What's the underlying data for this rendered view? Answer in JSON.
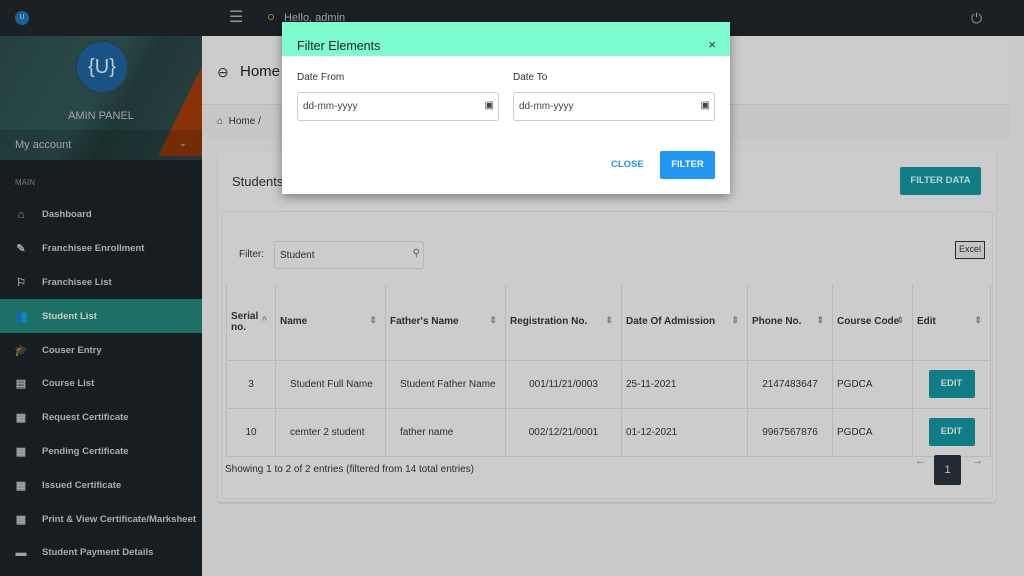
{
  "topbar": {
    "greeting": "Hello, admin",
    "logo": "U"
  },
  "sidebar": {
    "avatar": "{U}",
    "panel_name": "AMIN PANEL",
    "account": "My account",
    "section": "MAIN",
    "items": [
      {
        "label": "Dashboard",
        "icon": "⌂"
      },
      {
        "label": "Franchisee Enrollment",
        "icon": "✎"
      },
      {
        "label": "Franchisee List",
        "icon": "⚐"
      },
      {
        "label": "Student List",
        "icon": "👥"
      },
      {
        "label": "Couser Entry",
        "icon": "🎓"
      },
      {
        "label": "Course List",
        "icon": "▤"
      },
      {
        "label": "Request Certificate",
        "icon": "▦"
      },
      {
        "label": "Pending Certificate",
        "icon": "▦"
      },
      {
        "label": "Issued Certificate",
        "icon": "▦"
      },
      {
        "label": "Print & View Certificate/Marksheet",
        "icon": "▦"
      },
      {
        "label": "Student Payment Details",
        "icon": "▬"
      }
    ]
  },
  "header": {
    "title": "Home",
    "breadcrumb": "Home"
  },
  "card": {
    "title": "Students",
    "filter_data": "FILTER DATA",
    "filter_label": "Filter:",
    "filter_value": "Student",
    "excel": "Excel",
    "columns": [
      "Serial no.",
      "Name",
      "Father's Name",
      "Registration No.",
      "Date Of Admission",
      "Phone No.",
      "Course Code",
      "Edit"
    ],
    "rows": [
      [
        "3",
        "Student Full Name",
        "Student Father Name",
        "001/11/21/0003",
        "25-11-2021",
        "2147483647",
        "PGDCA",
        "EDIT"
      ],
      [
        "10",
        "cemter 2 student",
        "father name",
        "002/12/21/0001",
        "01-12-2021",
        "9967567876",
        "PGDCA",
        "EDIT"
      ]
    ],
    "info": "Showing 1 to 2 of 2 entries (filtered from 14 total entries)",
    "page": "1",
    "prev": "←",
    "next": "→"
  },
  "modal": {
    "title": "Filter Elements",
    "date_from_label": "Date From",
    "date_to_label": "Date To",
    "date_from_placeholder": "dd-mm-yyyy",
    "date_to_placeholder": "dd-mm-yyyy",
    "close": "CLOSE",
    "filter": "FILTER"
  }
}
